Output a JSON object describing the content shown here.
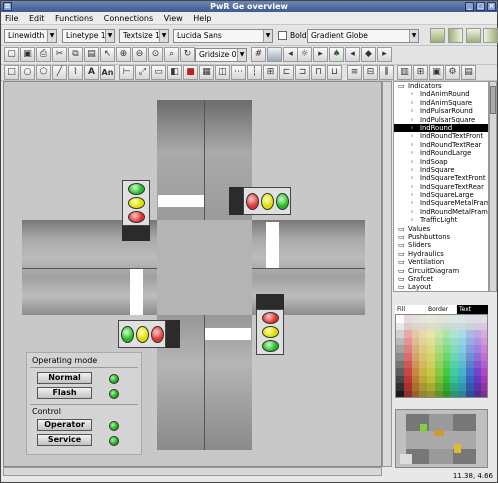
{
  "window": {
    "title": "PwR Ge  overview"
  },
  "menu": [
    "File",
    "Edit",
    "Functions",
    "Connections",
    "View",
    "Help"
  ],
  "toolbar": {
    "linewidth": "Linewidth 1",
    "linetype": "Linetype 1",
    "textsize": "Textsize 12",
    "font": "Lucida Sans",
    "bold_label": "Bold",
    "gradient": "Gradient Globe",
    "gridsize": "Gridsize 0.5"
  },
  "panel": {
    "operating_mode": "Operating mode",
    "normal": "Normal",
    "flash": "Flash",
    "control": "Control",
    "operator": "Operator",
    "service": "Service"
  },
  "tree": [
    {
      "label": "Indicators",
      "type": "folder-open",
      "level": 0
    },
    {
      "label": "IndAnimRound",
      "type": "item",
      "level": 1
    },
    {
      "label": "IndAnimSquare",
      "type": "item",
      "level": 1
    },
    {
      "label": "IndPulsarRound",
      "type": "item",
      "level": 1
    },
    {
      "label": "IndPulsarSquare",
      "type": "item",
      "level": 1
    },
    {
      "label": "IndRound",
      "type": "item",
      "level": 1,
      "selected": true
    },
    {
      "label": "IndRoundTextFront",
      "type": "item",
      "level": 1
    },
    {
      "label": "IndRoundTextRear",
      "type": "item",
      "level": 1
    },
    {
      "label": "IndRoundLarge",
      "type": "item",
      "level": 1
    },
    {
      "label": "IndSoap",
      "type": "item",
      "level": 1
    },
    {
      "label": "IndSquare",
      "type": "item",
      "level": 1
    },
    {
      "label": "IndSquareTextFront",
      "type": "item",
      "level": 1
    },
    {
      "label": "IndSquareTextRear",
      "type": "item",
      "level": 1
    },
    {
      "label": "IndSquareLarge",
      "type": "item",
      "level": 1
    },
    {
      "label": "IndSquareMetalFram",
      "type": "item",
      "level": 1
    },
    {
      "label": "IndRoundMetalFram",
      "type": "item",
      "level": 1
    },
    {
      "label": "TrafficLight",
      "type": "item",
      "level": 1
    },
    {
      "label": "Values",
      "type": "folder",
      "level": 0
    },
    {
      "label": "Pushbuttons",
      "type": "folder",
      "level": 0
    },
    {
      "label": "Sliders",
      "type": "folder",
      "level": 0
    },
    {
      "label": "Hydraulics",
      "type": "folder",
      "level": 0
    },
    {
      "label": "Ventilation",
      "type": "folder",
      "level": 0
    },
    {
      "label": "CircuitDiagram",
      "type": "folder",
      "level": 0
    },
    {
      "label": "Grafcet",
      "type": "folder",
      "level": 0
    },
    {
      "label": "Layout",
      "type": "folder",
      "level": 0
    }
  ],
  "palette": {
    "tabs": [
      "Fill",
      "Border",
      "Text"
    ]
  },
  "status": {
    "coords": "11.38, 4.66"
  }
}
